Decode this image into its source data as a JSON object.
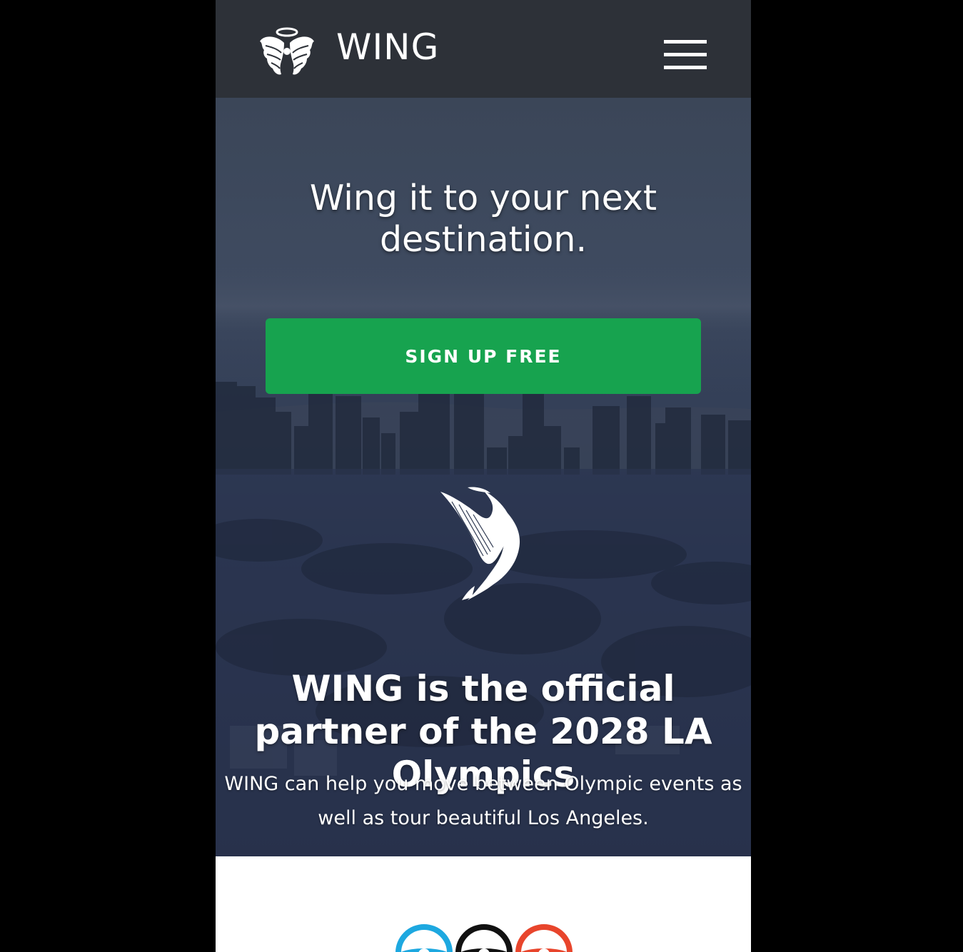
{
  "header": {
    "brand": "WING",
    "logo_icon": "winged-halo-logo-icon",
    "menu_icon": "hamburger-menu-icon"
  },
  "hero": {
    "title": "Wing it to your next destination.",
    "signup_label": "SIGN UP FREE",
    "signup_color": "#17a34f",
    "emblem_icon": "winged-figure-icon",
    "partner_title": "WING is the official partner of the 2028 LA Olympics",
    "partner_text": "WING can help you move between Olympic events as well as tour beautiful Los Angeles."
  },
  "features": {
    "icons": [
      {
        "name": "steering-wheel-icon",
        "color": "#1da8e0"
      },
      {
        "name": "steering-wheel-icon",
        "color": "#111111"
      },
      {
        "name": "steering-wheel-icon",
        "color": "#e8452c"
      }
    ]
  },
  "colors": {
    "header_bg": "#2d3138",
    "hero_overlay": "#2a3550",
    "page_bg": "#000000"
  }
}
